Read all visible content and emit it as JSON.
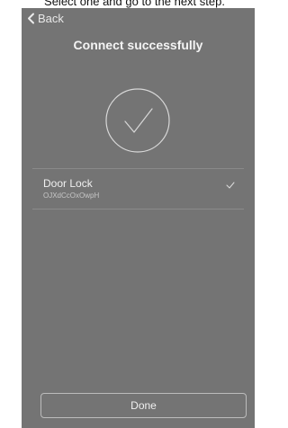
{
  "caption": "Select one and go to the next step.",
  "nav": {
    "back_label": "Back"
  },
  "header": {
    "title": "Connect successfully"
  },
  "devices": [
    {
      "name": "Door Lock",
      "id": "OJXdCcOxOwpH",
      "selected": true
    }
  ],
  "footer": {
    "done_label": "Done"
  },
  "colors": {
    "background": "#747474",
    "text": "#f4f4f4",
    "line": "#d8d8d8"
  },
  "icons": {
    "back": "chevron-left-icon",
    "success": "check-circle-icon",
    "selected": "check-icon"
  }
}
